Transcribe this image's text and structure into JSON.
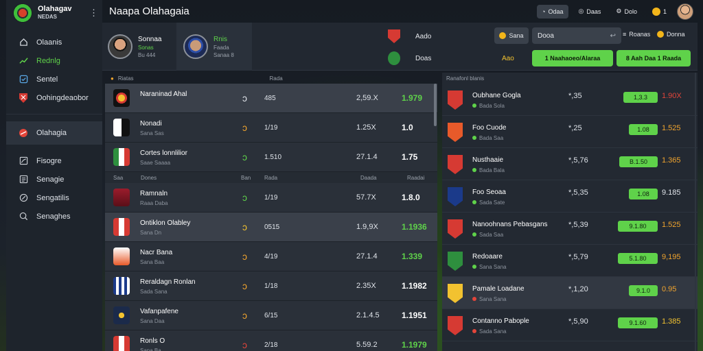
{
  "app": {
    "title": "Olahagav",
    "subtitle": "NEDAS"
  },
  "page": {
    "title": "Naapa Olahagaia"
  },
  "sidebar": {
    "items": [
      {
        "label": "Olaanis",
        "icon": "home-icon"
      },
      {
        "label": "Rednlg",
        "icon": "trend-icon"
      },
      {
        "label": "Sentel",
        "icon": "box-icon"
      },
      {
        "label": "Oohingdeaobor",
        "icon": "shield-icon"
      },
      {
        "label": "Olahagia",
        "icon": "ball-icon"
      },
      {
        "label": "Fisogre",
        "icon": "chart-icon"
      },
      {
        "label": "Senagie",
        "icon": "list-icon"
      },
      {
        "label": "Sengatilis",
        "icon": "tag-icon"
      },
      {
        "label": "Senaghes",
        "icon": "user-icon"
      }
    ]
  },
  "topbar": {
    "button1": "Odaa",
    "button2": "Daas",
    "button3": "Dolo",
    "coins": "1"
  },
  "match": {
    "player1": {
      "name": "Sonnaa",
      "meta1": "Sonas",
      "meta2": "Bu 444"
    },
    "player2": {
      "name": "Rnis",
      "meta1": "Faada",
      "meta2": "Sanaa 8"
    },
    "team1": {
      "label": "Aado"
    },
    "team2": {
      "label": "Doas"
    },
    "score_a": "Aao",
    "input_value": "Sana",
    "search_value": "Dooa",
    "link1": "Roanas",
    "link2": "Donna",
    "btn1": "1 Naahaoeo/Alaraa",
    "btn2": "8 Aah Daa 1 Raada"
  },
  "left_table": {
    "head": {
      "a": "Riatas",
      "b": "Rada"
    },
    "mid_head": {
      "a": "Saa",
      "b": "Dones",
      "c": "Ban",
      "d": "Rada",
      "e": "Daada",
      "f": "Raadai"
    },
    "rows": [
      {
        "team": "Naraninad Ahal",
        "sub": "",
        "c1": "485",
        "c2": "2,59.X",
        "c3": "1.979",
        "green": true
      },
      {
        "team": "Nonadi",
        "sub": "Sana Sas",
        "c1": "1/19",
        "c2": "1.25X",
        "c3": "1.0",
        "green": false
      },
      {
        "team": "Cortes lonnlilior",
        "sub": "Saae Saaaa",
        "c1": "1.510",
        "c2": "27.1.4",
        "c3": "1.75",
        "green": false
      },
      {
        "team": "Ramnaln",
        "sub": "Raaa Daba",
        "c1": "1/19",
        "c2": "57.7X",
        "c3": "1.8.0",
        "green": false
      },
      {
        "team": "Ontiklon Olabley",
        "sub": "Sana Dn",
        "c1": "0515",
        "c2": "1.9,9X",
        "c3": "1.1936",
        "green": true
      },
      {
        "team": "Nacr Bana",
        "sub": "Sana Baa",
        "c1": "4/19",
        "c2": "27.1.4",
        "c3": "1.339",
        "green": true
      },
      {
        "team": "Reraldagn Ronlan",
        "sub": "Sada Sana",
        "c1": "1/18",
        "c2": "2.35X",
        "c3": "1.1982",
        "green": false
      },
      {
        "team": "Vafanpafene",
        "sub": "Sana Daa",
        "c1": "6/15",
        "c2": "2.1.4.5",
        "c3": "1.1951",
        "green": false
      },
      {
        "team": "Ronls O",
        "sub": "Sana Ba",
        "c1": "2/18",
        "c2": "5.59.2",
        "c3": "1.1979",
        "green": true
      }
    ]
  },
  "right_table": {
    "head": "Ranafonl blanis",
    "rows": [
      {
        "name": "Oubhane Gogla",
        "sub": "Bada Sola",
        "odds": "*,35",
        "btn": "1,3.3",
        "pct": "1.90X"
      },
      {
        "name": "Foo Cuode",
        "sub": "Bada Saa",
        "odds": "*,25",
        "btn": "1.08",
        "pct": "1.525"
      },
      {
        "name": "Nusthaaie",
        "sub": "Bada Bala",
        "odds": "*,5,76",
        "btn": "B.1.50",
        "pct": "1.365"
      },
      {
        "name": "Foo Seoaa",
        "sub": "Sada Sate",
        "odds": "*,5,35",
        "btn": "1.08",
        "pct": "9.185"
      },
      {
        "name": "Nanoohnans Pebasgans",
        "sub": "Sada Saa",
        "odds": "*,5,39",
        "btn": "9.1.80",
        "pct": "1.525"
      },
      {
        "name": "Redoaare",
        "sub": "Sana Sana",
        "odds": "*,5,79",
        "btn": "5.1.80",
        "pct": "9,195"
      },
      {
        "name": "Pamale Loadane",
        "sub": "Sana Sana",
        "odds": "*,1,20",
        "btn": "9.1.0",
        "pct": "0.95"
      },
      {
        "name": "Contanno Pabople",
        "sub": "Sada Sana",
        "odds": "*,5,90",
        "btn": "9.1.60",
        "pct": "1.385"
      }
    ]
  },
  "colors": {
    "accent": "#5fd24a",
    "danger": "#e3453a",
    "warning": "#f2c230"
  }
}
